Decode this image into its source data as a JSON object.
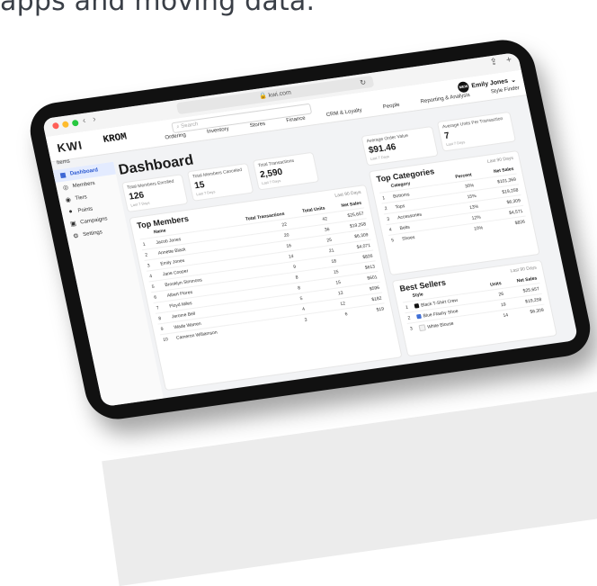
{
  "headline": "apps and moving data.",
  "browser": {
    "url": "kwi.com",
    "back_icon": "chevron-left",
    "forward_icon": "chevron-right",
    "share_icon": "share",
    "new_tab_icon": "plus"
  },
  "header": {
    "logo_kwi": "KWI",
    "logo_krom": "KROM",
    "search_placeholder": "Search",
    "user_initials": "MEW",
    "user_name": "Emily Jones",
    "nav": [
      "Ordering",
      "Inventory",
      "Stores",
      "Finance",
      "CRM & Loyalty",
      "People",
      "Reporting & Analysis",
      "Style Finder"
    ],
    "sub_nav": "Items"
  },
  "sidebar": {
    "items": [
      {
        "label": "Dashboard",
        "icon": "grid"
      },
      {
        "label": "Members",
        "icon": "user"
      },
      {
        "label": "Tiers",
        "icon": "layers"
      },
      {
        "label": "Points",
        "icon": "coin"
      },
      {
        "label": "Campaigns",
        "icon": "megaphone"
      },
      {
        "label": "Settings",
        "icon": "gear"
      }
    ]
  },
  "page_title": "Dashboard",
  "metrics": [
    {
      "label": "Total Members Enrolled",
      "value": "126",
      "sub": "Last 7 Days"
    },
    {
      "label": "Total Members Canceled",
      "value": "15",
      "sub": "Last 7 Days"
    },
    {
      "label": "Total Transactions",
      "value": "2,590",
      "sub": "Last 7 Days"
    },
    {
      "label": "Average Order Value",
      "value": "$91.46",
      "sub": "Last 7 Days"
    },
    {
      "label": "Average Units Per Transaction",
      "value": "7",
      "sub": "Last 7 Days"
    }
  ],
  "top_members": {
    "title": "Top Members",
    "period": "Last 90 Days",
    "columns": [
      "Name",
      "Total Transactions",
      "Total Units",
      "Net Sales"
    ],
    "rows": [
      [
        "1",
        "Jacob Jones",
        "22",
        "42",
        "$25,657"
      ],
      [
        "2",
        "Annette Black",
        "20",
        "36",
        "$19,258"
      ],
      [
        "3",
        "Emily Jones",
        "16",
        "25",
        "$6,309"
      ],
      [
        "4",
        "Jane Cooper",
        "14",
        "21",
        "$4,071"
      ],
      [
        "5",
        "Brooklyn Simmons",
        "9",
        "18",
        "$826"
      ],
      [
        "6",
        "Albert Flores",
        "8",
        "15",
        "$613"
      ],
      [
        "7",
        "Floyd Miles",
        "8",
        "15",
        "$601"
      ],
      [
        "8",
        "Jerome Bell",
        "5",
        "13",
        "$596"
      ],
      [
        "9",
        "Wade Warren",
        "4",
        "12",
        "$182"
      ],
      [
        "10",
        "Cameron Williamson",
        "3",
        "6",
        "$19"
      ]
    ]
  },
  "top_categories": {
    "title": "Top Categories",
    "period": "Last 90 Days",
    "columns": [
      "Category",
      "Percent",
      "Net Sales"
    ],
    "rows": [
      [
        "1",
        "Bottoms",
        "30%",
        "$101,369"
      ],
      [
        "2",
        "Tops",
        "15%",
        "$19,258"
      ],
      [
        "3",
        "Accessories",
        "13%",
        "$6,309"
      ],
      [
        "4",
        "Belts",
        "12%",
        "$4,571"
      ],
      [
        "5",
        "Shoes",
        "10%",
        "$826"
      ]
    ]
  },
  "best_sellers": {
    "title": "Best Sellers",
    "period": "Last 90 Days",
    "columns": [
      "Style",
      "Units",
      "Net Sales"
    ],
    "rows": [
      [
        "1",
        "Black T-Shirt Crew",
        "26",
        "$25,657"
      ],
      [
        "2",
        "Blue Flashy Shoe",
        "19",
        "$19,258"
      ],
      [
        "3",
        "White Blouse",
        "14",
        "$6,309"
      ]
    ]
  }
}
